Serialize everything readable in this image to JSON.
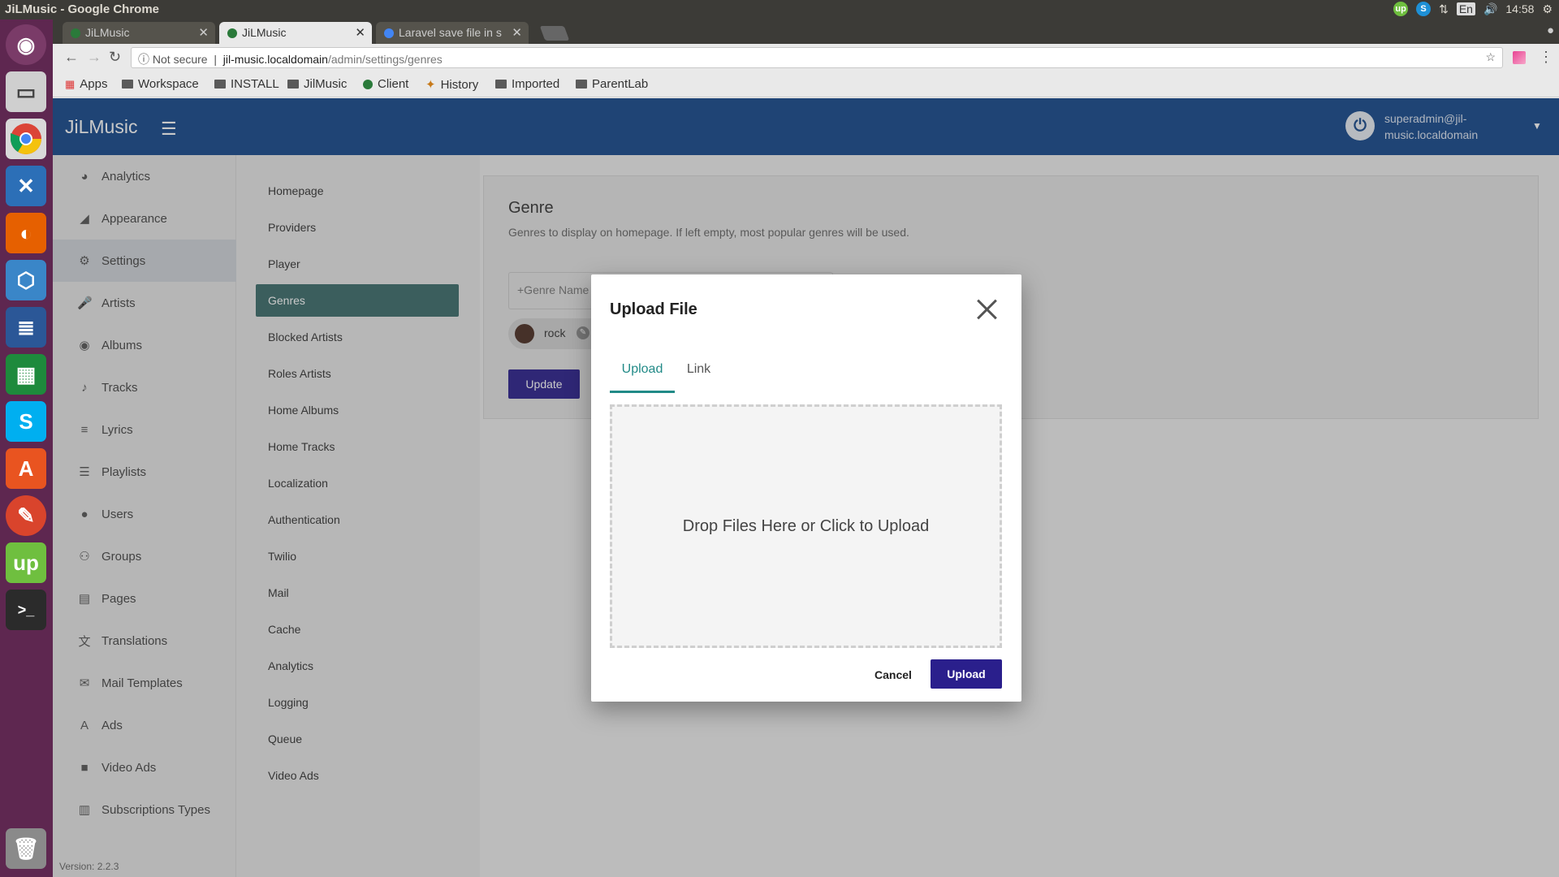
{
  "os": {
    "window_title": "JiLMusic - Google Chrome",
    "clock": "14:58",
    "lang": "En"
  },
  "browser": {
    "tabs": [
      {
        "label": "JiLMusic"
      },
      {
        "label": "JiLMusic"
      },
      {
        "label": "Laravel save file in s"
      }
    ],
    "address": {
      "security": "Not secure",
      "host": "jil-music.localdomain",
      "path": "/admin/settings/genres"
    },
    "bookmarks": [
      "Apps",
      "Workspace",
      "INSTALL",
      "JilMusic",
      "Client",
      "History",
      "Imported",
      "ParentLab"
    ]
  },
  "app": {
    "logo": "JiLMusic",
    "user": "superadmin@jil-music.localdomain",
    "version": "Version: 2.2.3"
  },
  "sidebar": {
    "items": [
      {
        "label": "Analytics",
        "icon": "pie-chart-icon"
      },
      {
        "label": "Appearance",
        "icon": "brush-icon"
      },
      {
        "label": "Settings",
        "icon": "gear-icon"
      },
      {
        "label": "Artists",
        "icon": "mic-icon"
      },
      {
        "label": "Albums",
        "icon": "album-icon"
      },
      {
        "label": "Tracks",
        "icon": "music-note-icon"
      },
      {
        "label": "Lyrics",
        "icon": "lyrics-icon"
      },
      {
        "label": "Playlists",
        "icon": "playlist-icon"
      },
      {
        "label": "Users",
        "icon": "person-icon"
      },
      {
        "label": "Groups",
        "icon": "people-icon"
      },
      {
        "label": "Pages",
        "icon": "page-icon"
      },
      {
        "label": "Translations",
        "icon": "translate-icon"
      },
      {
        "label": "Mail Templates",
        "icon": "mail-icon"
      },
      {
        "label": "Ads",
        "icon": "ads-icon"
      },
      {
        "label": "Video Ads",
        "icon": "video-icon"
      },
      {
        "label": "Subscriptions Types",
        "icon": "subscriptions-icon"
      }
    ]
  },
  "subnav": {
    "items": [
      "Homepage",
      "Providers",
      "Player",
      "Genres",
      "Blocked Artists",
      "Roles Artists",
      "Home Albums",
      "Home Tracks",
      "Localization",
      "Authentication",
      "Twilio",
      "Mail",
      "Cache",
      "Analytics",
      "Logging",
      "Queue",
      "Video Ads"
    ]
  },
  "genre_panel": {
    "title": "Genre",
    "description": "Genres to display on homepage. If left empty, most popular genres will be used.",
    "input_placeholder": "+Genre Name",
    "chip": "rock",
    "update_label": "Update"
  },
  "dialog": {
    "title": "Upload File",
    "tabs": [
      "Upload",
      "Link"
    ],
    "dropzone_text": "Drop Files Here or Click to Upload",
    "cancel_label": "Cancel",
    "upload_label": "Upload"
  },
  "colors": {
    "header": "#14478b",
    "accent": "#218a87",
    "primary_button": "#2a1f8c",
    "launcher": "#5e2750"
  }
}
